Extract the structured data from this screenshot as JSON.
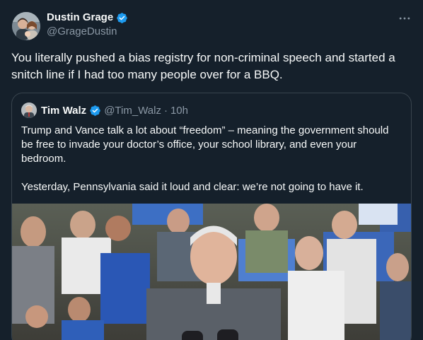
{
  "tweet": {
    "author": {
      "display_name": "Dustin Grage",
      "handle": "@GrageDustin",
      "verified": true
    },
    "more_icon": "more-horizontal-icon",
    "text": "You literally pushed a bias registry for non-criminal speech and started a snitch line if I had too many people over for a BBQ."
  },
  "quoted_tweet": {
    "author": {
      "display_name": "Tim Walz",
      "handle": "@Tim_Walz",
      "verified": true
    },
    "separator": "·",
    "time": "10h",
    "paragraphs": [
      "Trump and Vance talk a lot about “freedom” – meaning the government should be free to invade your doctor’s office, your school library, and even your bedroom.",
      "Yesterday, Pennsylvania said it loud and clear: we’re not going to have it."
    ]
  },
  "colors": {
    "background": "#15202b",
    "text_primary": "#f7f9f9",
    "text_secondary": "#8b98a5",
    "border": "#38444d",
    "verified_blue": "#1d9bf0"
  }
}
